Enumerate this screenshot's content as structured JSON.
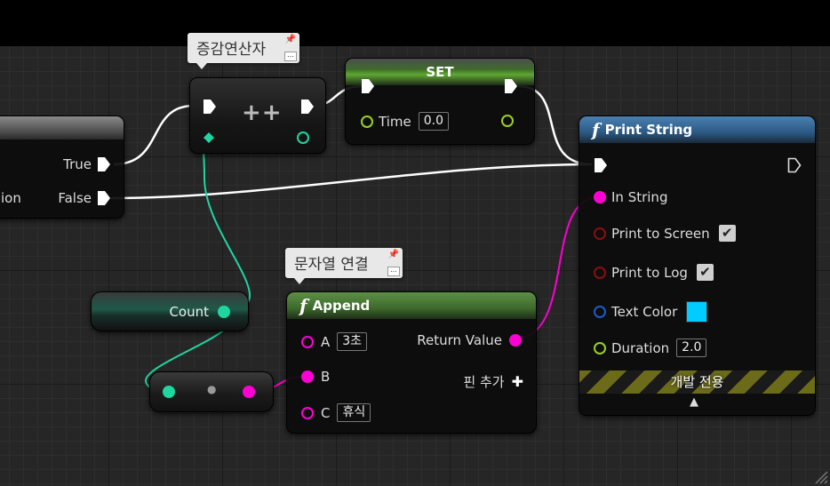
{
  "comments": {
    "increment": "증감연산자",
    "append": "문자열 연결"
  },
  "branch_node": {
    "true_label": "True",
    "false_label": "False",
    "cut_label": "ion"
  },
  "increment_node": {
    "title": "++"
  },
  "set_node": {
    "title": "SET",
    "var_label": "Time",
    "var_value": "0.0"
  },
  "print_node": {
    "title": "Print String",
    "in_string_label": "In String",
    "print_screen_label": "Print to Screen",
    "print_log_label": "Print to Log",
    "text_color_label": "Text Color",
    "duration_label": "Duration",
    "duration_value": "2.0",
    "dev_only_label": "개발 전용",
    "check_mark": "✔",
    "collapse_glyph": "▲",
    "text_color": "#00ccff"
  },
  "count_node": {
    "label": "Count"
  },
  "append_node": {
    "title": "Append",
    "a_label": "A",
    "a_value": "3초",
    "b_label": "B",
    "c_label": "C",
    "c_value": "휴식",
    "return_label": "Return Value",
    "add_pin_label": "핀 추가",
    "add_pin_glyph": "✚"
  },
  "convert_node": {
    "center_glyph": "●"
  },
  "colors": {
    "exec": "#ffffff",
    "integer": "#1fd6a0",
    "string": "#ff00d4",
    "float": "#9ad025",
    "bool": "#8a0f0f",
    "linear_color": "#1e5ac8",
    "function_header": "#3c6fa0",
    "set_header": "#6aa83a",
    "append_header": "#4f8a3a"
  }
}
